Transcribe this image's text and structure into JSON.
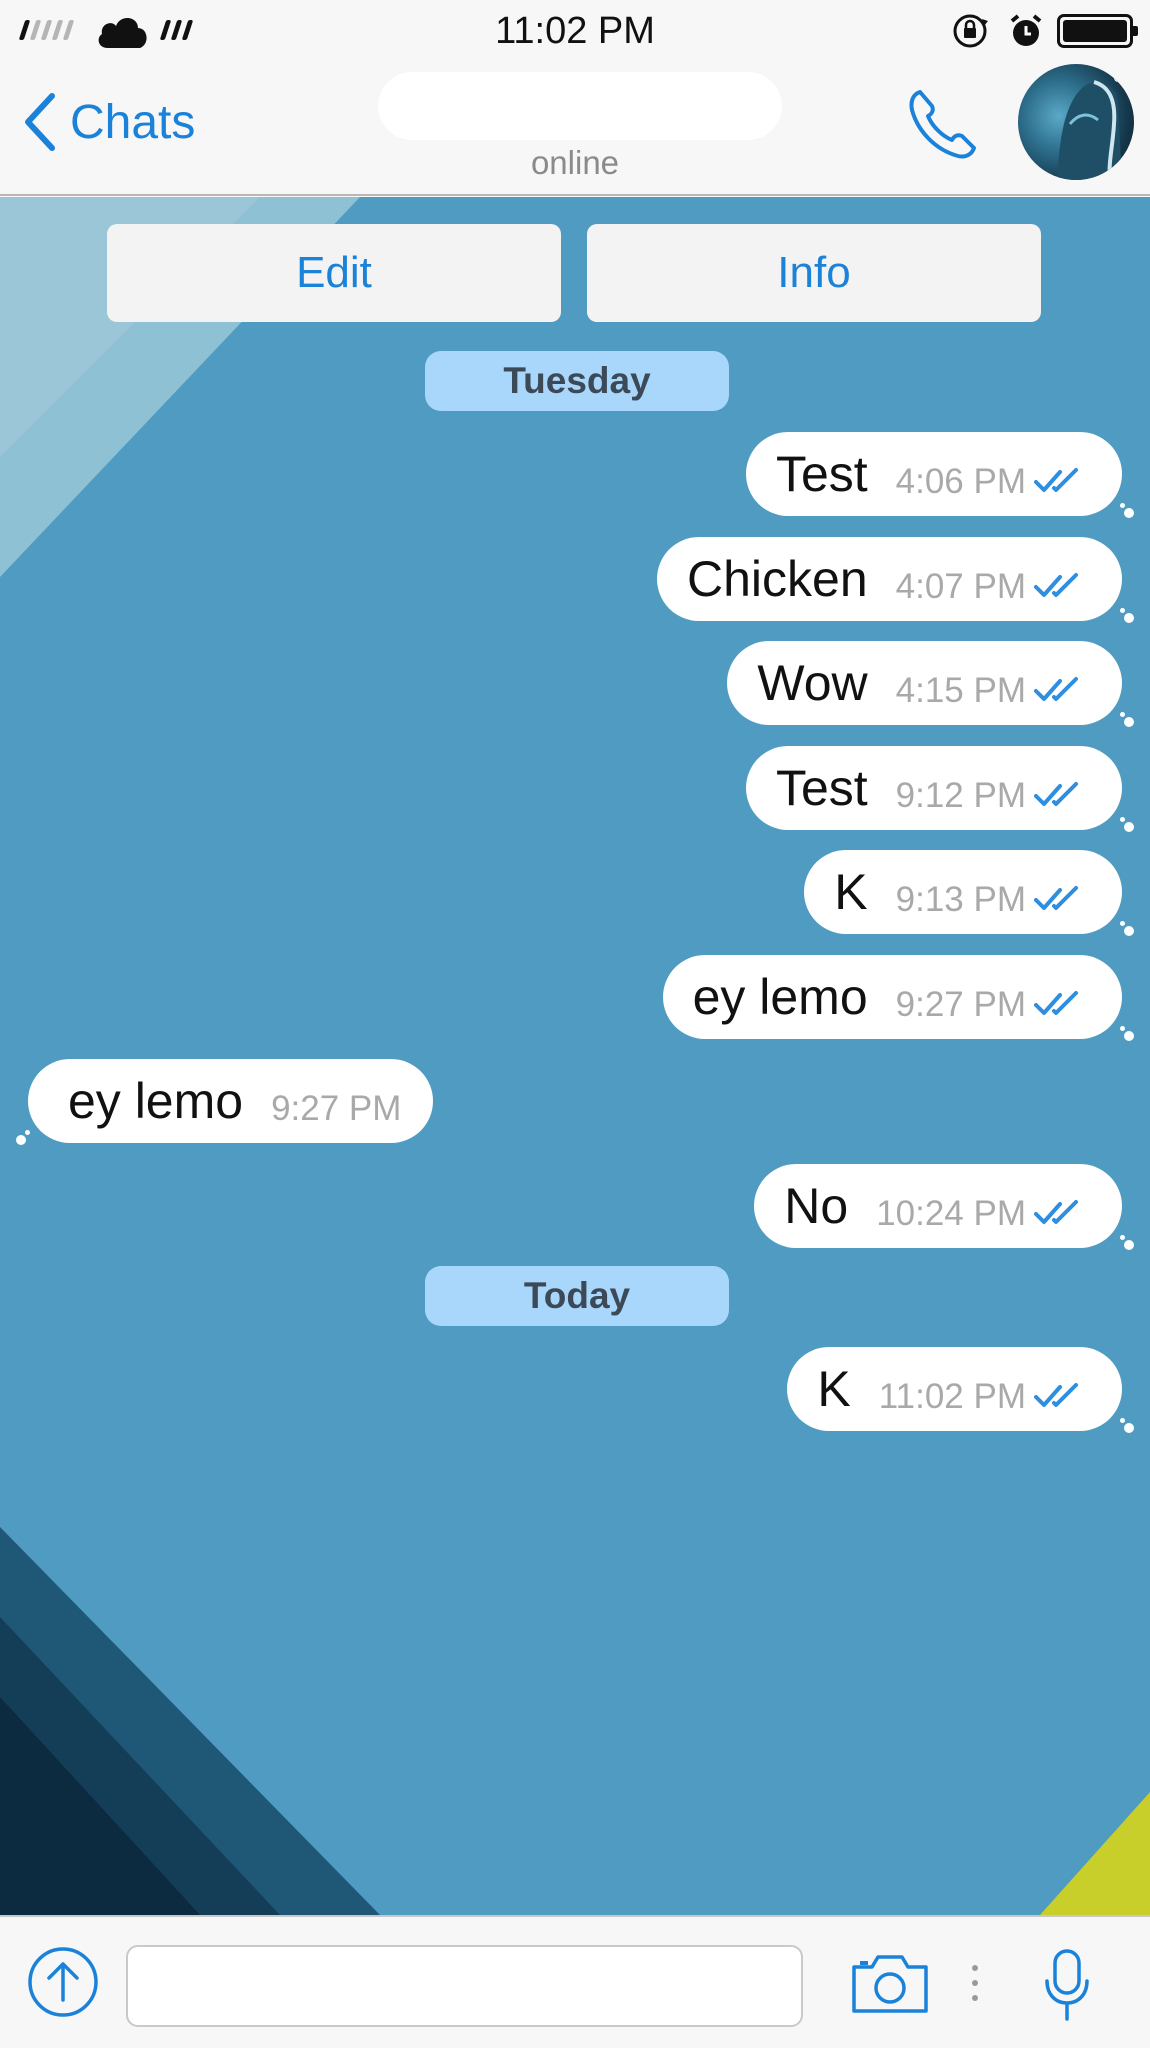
{
  "status_bar": {
    "time": "11:02 PM",
    "icons": [
      "signal-icon",
      "cloud-icon",
      "wifi-icon",
      "rotation-lock-icon",
      "alarm-icon",
      "battery-icon"
    ]
  },
  "nav": {
    "back_label": "Chats",
    "subtitle": "online",
    "icons": [
      "chevron-left-icon",
      "phone-icon",
      "avatar"
    ]
  },
  "chat": {
    "actions": {
      "edit_label": "Edit",
      "info_label": "Info"
    },
    "date_dividers": [
      "Tuesday",
      "Today"
    ],
    "messages": [
      {
        "text": "Test",
        "time": "4:06 PM",
        "direction": "outgoing",
        "read": true
      },
      {
        "text": "Chicken",
        "time": "4:07 PM",
        "direction": "outgoing",
        "read": true
      },
      {
        "text": "Wow",
        "time": "4:15 PM",
        "direction": "outgoing",
        "read": true
      },
      {
        "text": "Test",
        "time": "9:12 PM",
        "direction": "outgoing",
        "read": true
      },
      {
        "text": "K",
        "time": "9:13 PM",
        "direction": "outgoing",
        "read": true
      },
      {
        "text": "ey lemo",
        "time": "9:27 PM",
        "direction": "outgoing",
        "read": true
      },
      {
        "text": "ey lemo",
        "time": "9:27 PM",
        "direction": "incoming",
        "read": false
      },
      {
        "text": "No",
        "time": "10:24 PM",
        "direction": "outgoing",
        "read": true
      },
      {
        "text": "K",
        "time": "11:02 PM",
        "direction": "outgoing",
        "read": true
      }
    ]
  },
  "input_bar": {
    "message_value": "",
    "icons": [
      "upload-icon",
      "camera-icon",
      "more-icon",
      "microphone-icon"
    ]
  },
  "colors": {
    "accent": "#1a82d9",
    "chat_background": "#4f9bc1",
    "date_pill": "#a9d6fb",
    "bubble": "#ffffff",
    "timestamp": "#a9a9a9",
    "bar_background": "#f7f7f7"
  }
}
